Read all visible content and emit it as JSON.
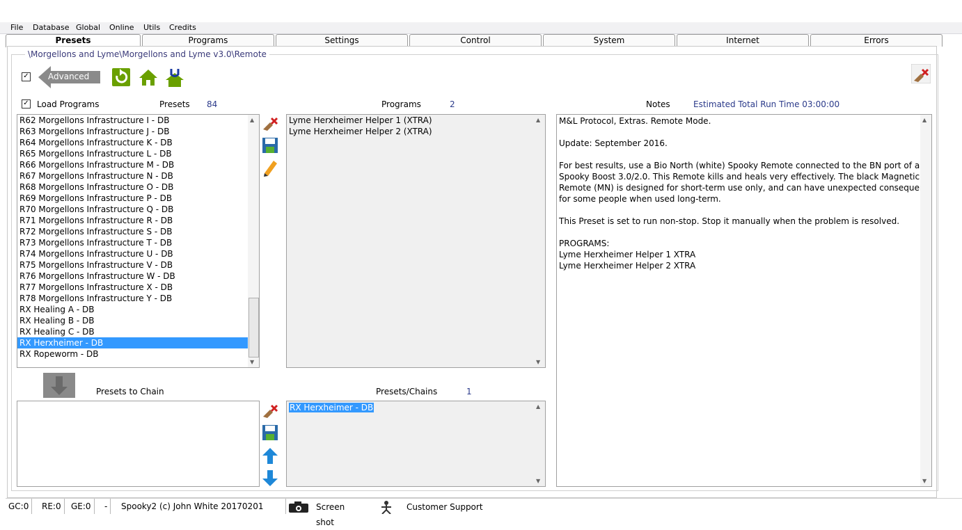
{
  "menu": [
    "File",
    "Database",
    "Global",
    "Online",
    "Utils",
    "Credits"
  ],
  "tabs": [
    "Presets",
    "Programs",
    "Settings",
    "Control",
    "System",
    "Internet",
    "Errors"
  ],
  "path": "\\Morgellons and Lyme\\Morgellons and Lyme v3.0\\Remote",
  "advanced_label": "Advanced",
  "load_programs_label": "Load Programs",
  "presets_label": "Presets",
  "presets_count": "84",
  "programs_label": "Programs",
  "programs_count": "2",
  "notes_label": "Notes",
  "run_time": "Estimated Total Run Time 03:00:00",
  "preset_items": [
    "R62 Morgellons Infrastructure I - DB",
    "R63 Morgellons Infrastructure J - DB",
    "R64 Morgellons Infrastructure K - DB",
    "R65 Morgellons Infrastructure L - DB",
    "R66 Morgellons Infrastructure M - DB",
    "R67 Morgellons Infrastructure N - DB",
    "R68 Morgellons Infrastructure O - DB",
    "R69 Morgellons Infrastructure P - DB",
    "R70 Morgellons Infrastructure Q - DB",
    "R71 Morgellons Infrastructure R - DB",
    "R72 Morgellons Infrastructure S - DB",
    "R73 Morgellons Infrastructure T - DB",
    "R74 Morgellons Infrastructure U - DB",
    "R75 Morgellons Infrastructure V - DB",
    "R76 Morgellons Infrastructure W - DB",
    "R77 Morgellons Infrastructure X - DB",
    "R78 Morgellons Infrastructure Y - DB",
    "RX Healing A - DB",
    "RX Healing B - DB",
    "RX Healing C - DB",
    "RX Herxheimer - DB",
    "RX Ropeworm - DB"
  ],
  "selected_preset": "RX Herxheimer - DB",
  "program_items": [
    "Lyme Herxheimer Helper 1 (XTRA)",
    "Lyme Herxheimer Helper 2 (XTRA)"
  ],
  "notes_lines": [
    "M&L Protocol, Extras. Remote Mode.",
    "",
    "Update: September 2016.",
    "",
    "For best results, use a Bio North (white) Spooky Remote connected to the BN port of a",
    "Spooky Boost 3.0/2.0. This Remote kills and heals very effectively. The black Magnetic",
    "Remote (MN) is designed for short-term use only, and can have unexpected consequences",
    "for some people when used long-term.",
    "",
    "This Preset is set to run non-stop. Stop it manually when the problem is resolved.",
    "",
    "PROGRAMS:",
    "Lyme Herxheimer Helper 1 XTRA",
    "Lyme Herxheimer Helper 2 XTRA"
  ],
  "presets_to_chain_label": "Presets to Chain",
  "chains_label": "Presets/Chains",
  "chains_count": "1",
  "chain_items": [
    "RX Herxheimer - DB"
  ],
  "status": {
    "gc": "GC:0",
    "re": "RE:0",
    "ge": "GE:0",
    "dash": "-",
    "copyright": "Spooky2 (c) John White 20170201",
    "screenshot": "Screen shot",
    "support": "Customer Support"
  },
  "colors": {
    "selection": "#3399ff",
    "accent": "#2b3a8a",
    "icon_green": "#6aa000"
  }
}
